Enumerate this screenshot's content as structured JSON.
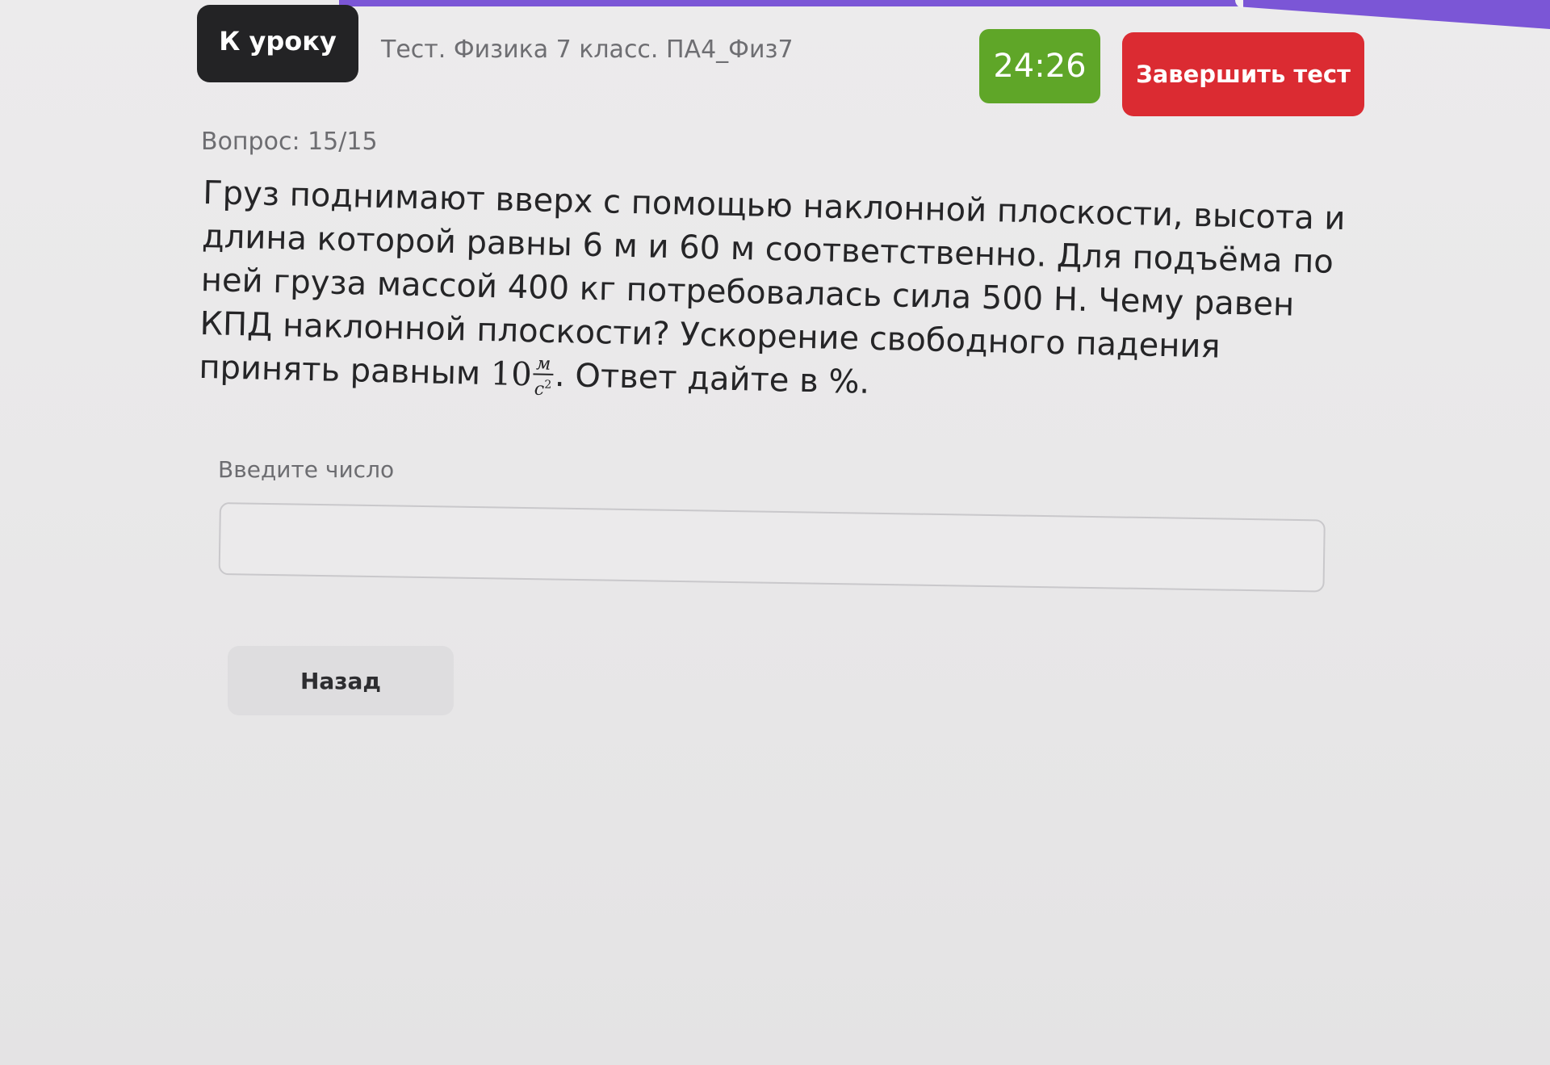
{
  "header": {
    "back_label": "К уроку",
    "test_title": "Тест. Физика 7 класс. ПА4_Физ7",
    "timer": "24:26",
    "finish_label": "Завершить тест"
  },
  "question": {
    "counter": "Вопрос: 15/15",
    "lines": [
      "Груз поднимают вверх с помощью наклонной плоскости, высота и",
      "длина которой равны 6 м и 60 м соответственно. Для подъёма по",
      "ней груза массой 400 кг потребовалась сила 500 Н. Чему равен",
      "КПД наклонной плоскости? Ускорение свободного падения"
    ],
    "last_line_prefix": "принять равным ",
    "g_value": "10",
    "g_unit_numerator": "м",
    "g_unit_denominator": "с",
    "g_unit_denominator_power": "2",
    "last_line_suffix": ". Ответ дайте в %."
  },
  "answer": {
    "label": "Введите число",
    "value": "",
    "placeholder": ""
  },
  "footer": {
    "back_label": "Назад"
  },
  "colors": {
    "accent_purple": "#7b56d6",
    "timer_green": "#5fa628",
    "finish_red": "#db2b32",
    "dark_button": "#232325"
  }
}
